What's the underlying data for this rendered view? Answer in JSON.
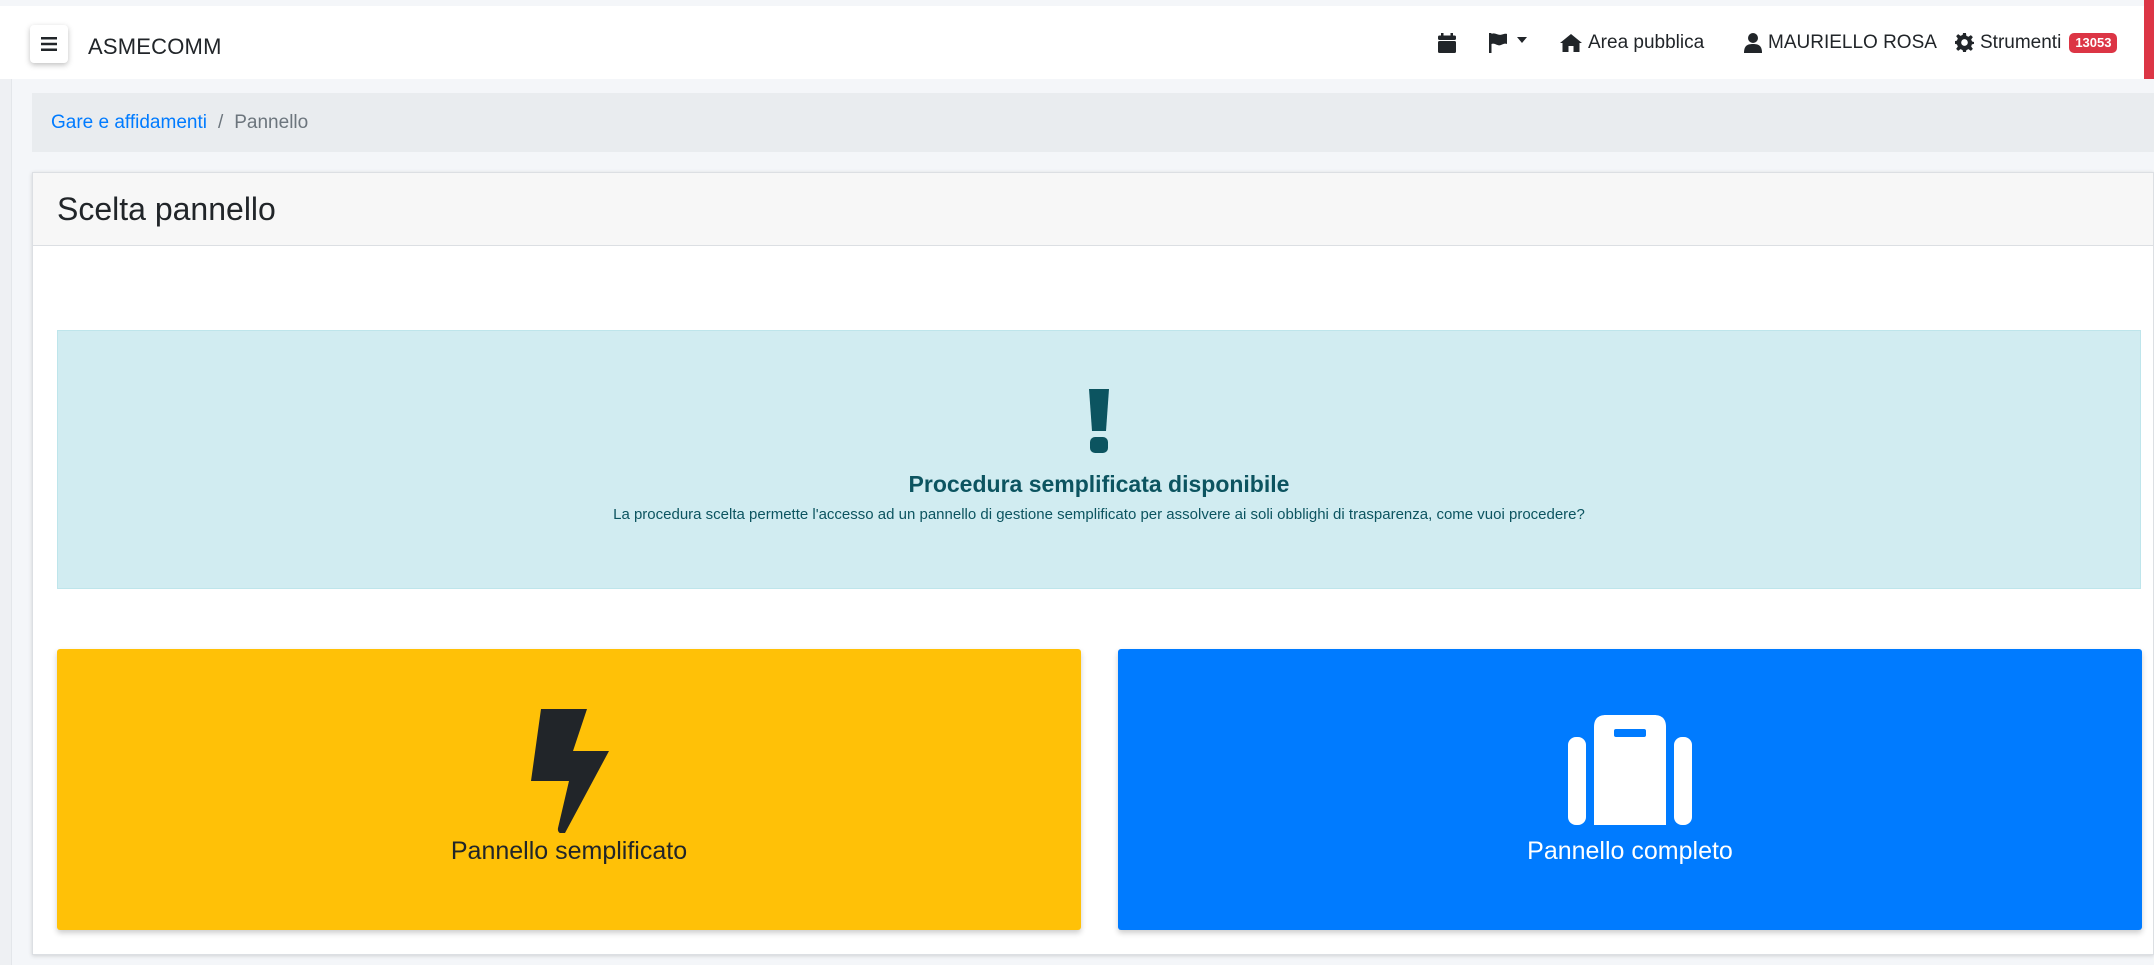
{
  "app": {
    "brand": "ASMECOMM"
  },
  "navbar": {
    "calendar_icon": "calendar-icon",
    "flag_icon": "flag-icon",
    "public_area": "Area pubblica",
    "user_name": "MAURIELLO ROSA",
    "tools_label": "Strumenti",
    "tools_badge": "13053",
    "colors": {
      "badge": "#dc3545"
    }
  },
  "breadcrumb": {
    "parent": "Gare e affidamenti",
    "separator": "/",
    "current": "Pannello"
  },
  "card": {
    "title": "Scelta pannello"
  },
  "alert": {
    "title": "Procedura semplificata disponibile",
    "text": "La procedura scelta permette l'accesso ad un pannello di gestione semplificato per assolvere ai soli obblighi di trasparenza, come vuoi procedere?",
    "icon": "exclamation-icon",
    "colors": {
      "background": "#d1ecf1",
      "text": "#0c5460"
    }
  },
  "panels": {
    "simple": {
      "label": "Pannello semplificato",
      "icon": "bolt-icon",
      "color": "#ffc107"
    },
    "full": {
      "label": "Pannello completo",
      "icon": "briefcase-icon",
      "color": "#007bff"
    }
  }
}
